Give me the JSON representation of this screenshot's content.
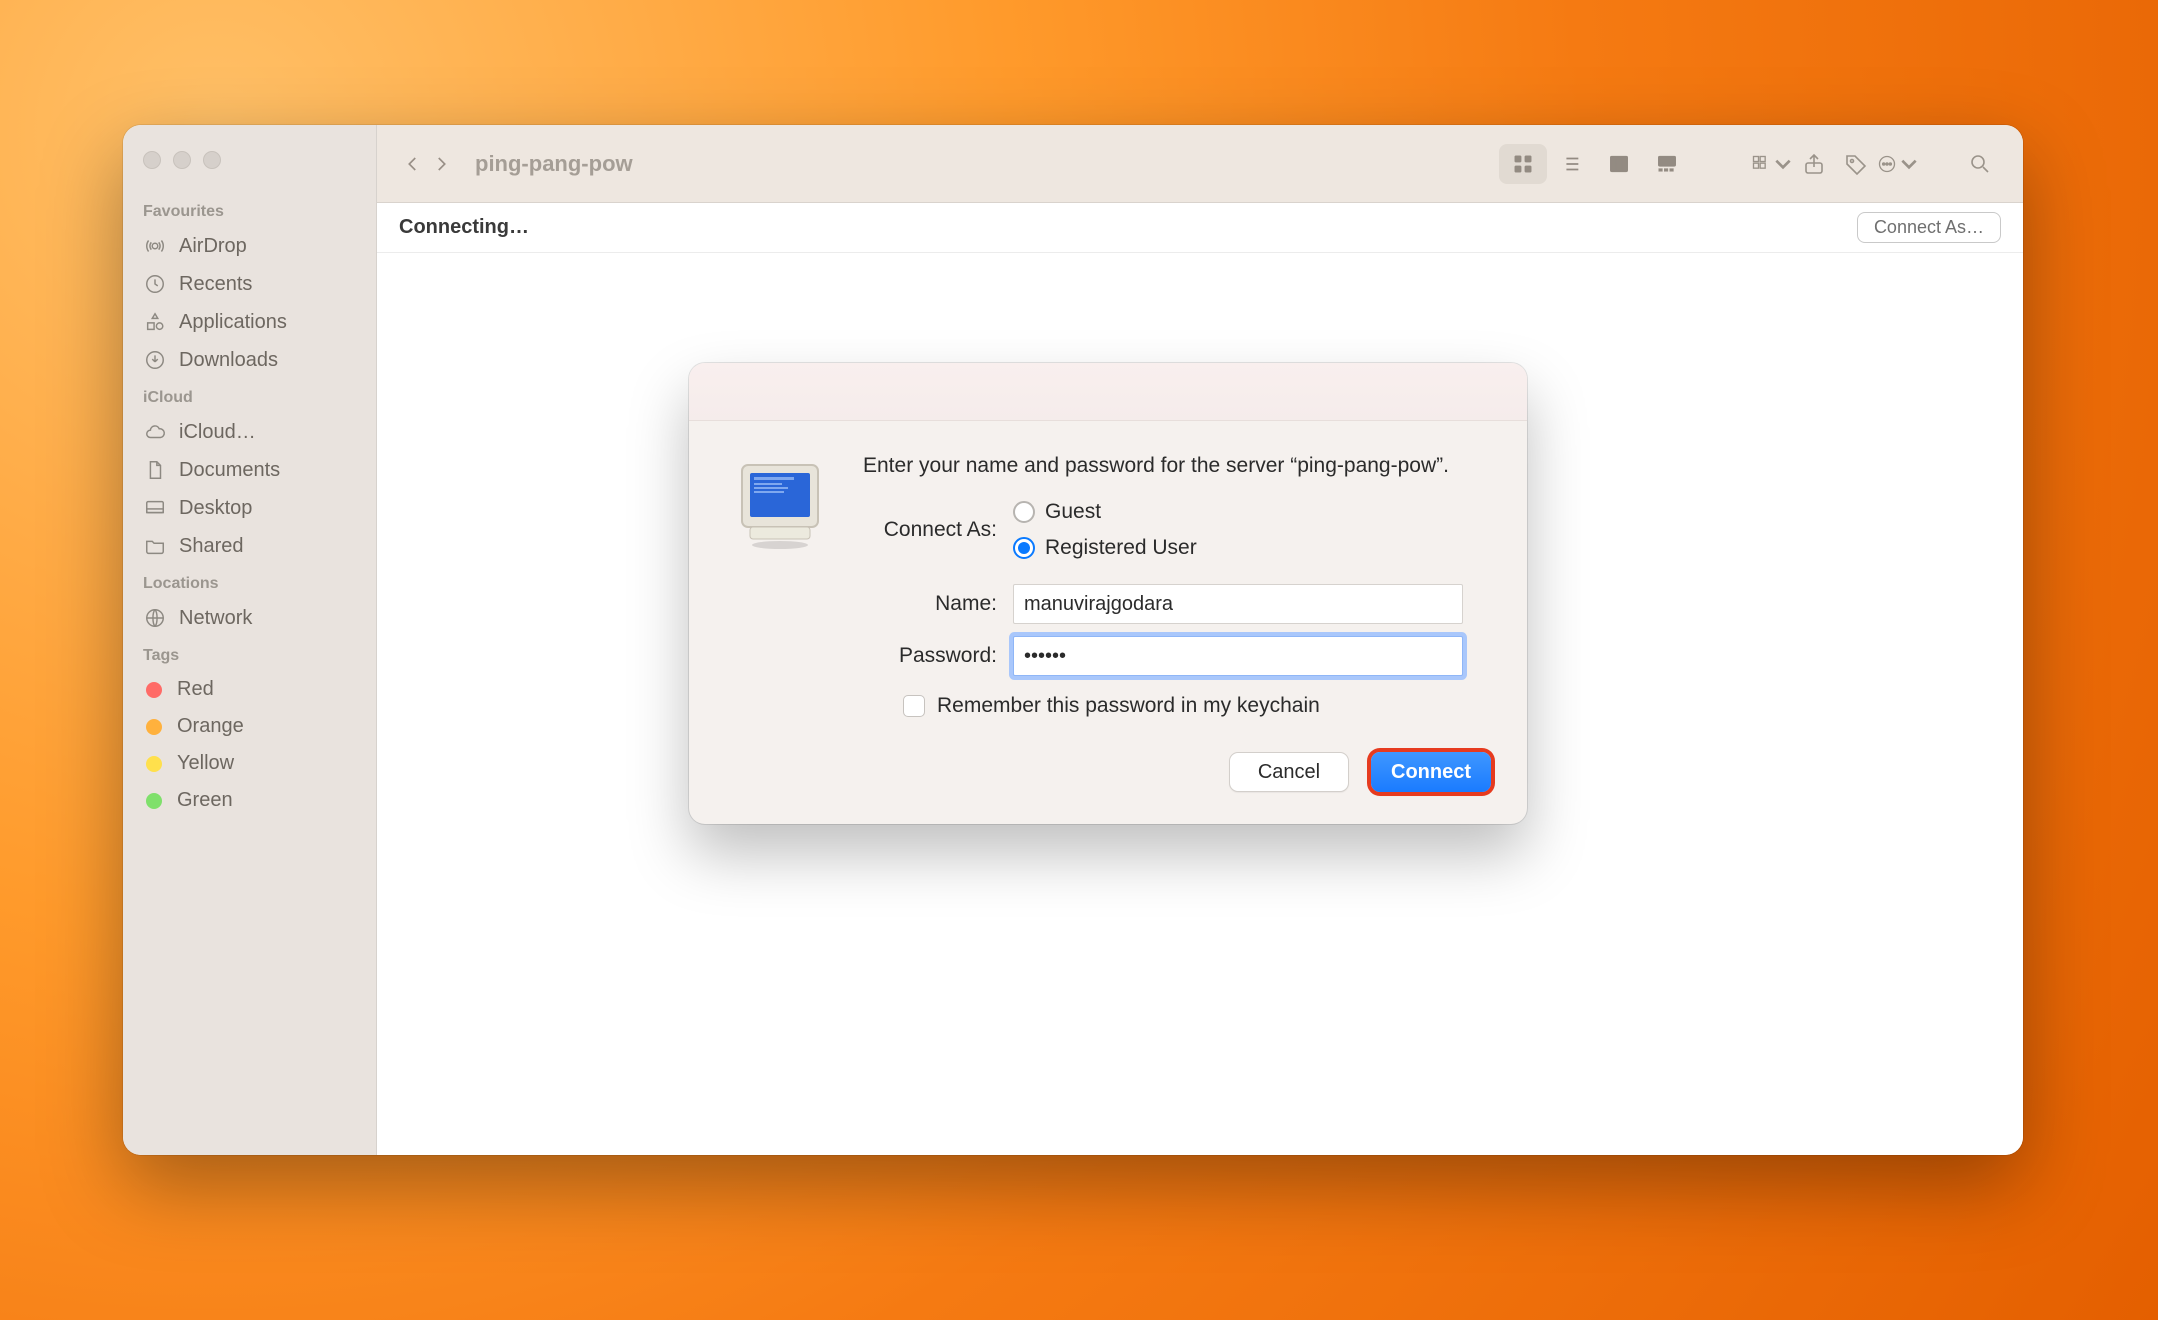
{
  "window": {
    "title": "ping-pang-pow",
    "status": "Connecting…",
    "connect_as_label": "Connect As…"
  },
  "sidebar": {
    "groups": [
      {
        "title": "Favourites",
        "items": [
          {
            "icon": "airdrop-icon",
            "label": "AirDrop"
          },
          {
            "icon": "clock-icon",
            "label": "Recents"
          },
          {
            "icon": "apps-icon",
            "label": "Applications"
          },
          {
            "icon": "download-icon",
            "label": "Downloads"
          }
        ]
      },
      {
        "title": "iCloud",
        "items": [
          {
            "icon": "cloud-icon",
            "label": "iCloud…"
          },
          {
            "icon": "doc-icon",
            "label": "Documents"
          },
          {
            "icon": "desktop-icon",
            "label": "Desktop"
          },
          {
            "icon": "folder-icon",
            "label": "Shared"
          }
        ]
      },
      {
        "title": "Locations",
        "items": [
          {
            "icon": "globe-icon",
            "label": "Network"
          }
        ]
      },
      {
        "title": "Tags",
        "items": [
          {
            "color": "#ff6b67",
            "label": "Red"
          },
          {
            "color": "#ffb13d",
            "label": "Orange"
          },
          {
            "color": "#ffe04c",
            "label": "Yellow"
          },
          {
            "color": "#7fe06b",
            "label": "Green"
          }
        ]
      }
    ]
  },
  "dialog": {
    "prompt": "Enter your name and password for the server “ping-pang-pow”.",
    "connect_as_label": "Connect As:",
    "radio_guest": "Guest",
    "radio_registered": "Registered User",
    "name_label": "Name:",
    "name_value": "manuvirajgodara",
    "password_label": "Password:",
    "password_value": "••••••",
    "remember_label": "Remember this password in my keychain",
    "cancel_label": "Cancel",
    "connect_label": "Connect"
  }
}
